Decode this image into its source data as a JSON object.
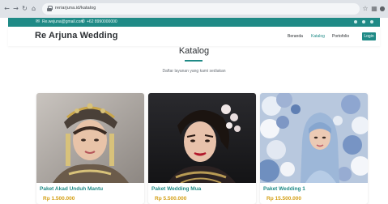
{
  "browser": {
    "url": "reriarjuna.id/katalog",
    "nav_icons": [
      "back-arrow-icon",
      "forward-arrow-icon",
      "reload-icon",
      "home-icon"
    ],
    "action_icons": [
      "star-icon",
      "extension-icon",
      "profile-icon"
    ]
  },
  "topbar": {
    "email": "Re.wejuna@gmail.com",
    "phone": "+62 8990000000",
    "color": "#1f8a86"
  },
  "header": {
    "brand": "Re Arjuna Wedding",
    "menu": [
      {
        "label": "Beranda",
        "active": false
      },
      {
        "label": "Katalog",
        "active": true
      },
      {
        "label": "Portofolio",
        "active": false
      }
    ],
    "login_label": "Login"
  },
  "section": {
    "title": "Katalog",
    "subtitle": "Daftar layanan yang kami sediakan"
  },
  "cards": [
    {
      "name": "Paket Akad Unduh Mantu",
      "price": "Rp 1.500.000"
    },
    {
      "name": "Paket Wedding Mua",
      "price": "Rp 5.500.000"
    },
    {
      "name": "Paket Wedding 1",
      "price": "Rp 15.500.000"
    }
  ],
  "colors": {
    "accent": "#1f8a86",
    "price": "#d4a017",
    "text": "#2b2f33"
  }
}
